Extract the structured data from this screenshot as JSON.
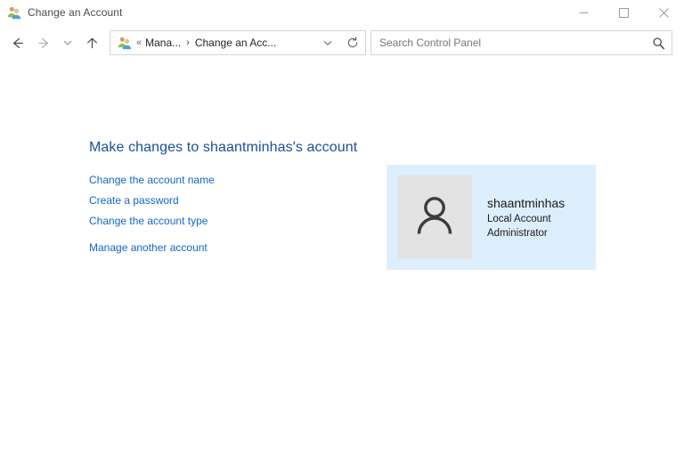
{
  "window": {
    "title": "Change an Account",
    "app_icon": "user-accounts-icon",
    "controls": {
      "minimize": "Minimize",
      "maximize": "Maximize",
      "close": "Close"
    }
  },
  "navbar": {
    "back": "Back",
    "forward": "Forward",
    "recent": "Recent locations",
    "up": "Up one level",
    "address": {
      "icon": "user-accounts-icon",
      "overflow": "«",
      "crumbs": [
        {
          "label": "Mana...",
          "separator": "›"
        },
        {
          "label": "Change an Acc...",
          "separator": ""
        }
      ],
      "dropdown": "Previous locations",
      "refresh": "Refresh"
    },
    "search": {
      "placeholder": "Search Control Panel",
      "value": "",
      "icon": "search-icon"
    }
  },
  "main": {
    "heading": "Make changes to shaantminhas's account",
    "task_links": [
      {
        "label": "Change the account name",
        "spaced": false
      },
      {
        "label": "Create a password",
        "spaced": false
      },
      {
        "label": "Change the account type",
        "spaced": false
      },
      {
        "label": "Manage another account",
        "spaced": true
      }
    ],
    "account_card": {
      "avatar_icon": "user-avatar-icon",
      "name": "shaantminhas",
      "type": "Local Account",
      "role": "Administrator"
    }
  },
  "colors": {
    "heading_blue": "#19509b",
    "link_blue": "#1565c8",
    "card_background": "#ddeffc",
    "avatar_background": "#e3e3e3",
    "avatar_glyph": "#3c3c3c",
    "window_background": "#ffffff",
    "border": "#d4d4d4"
  }
}
